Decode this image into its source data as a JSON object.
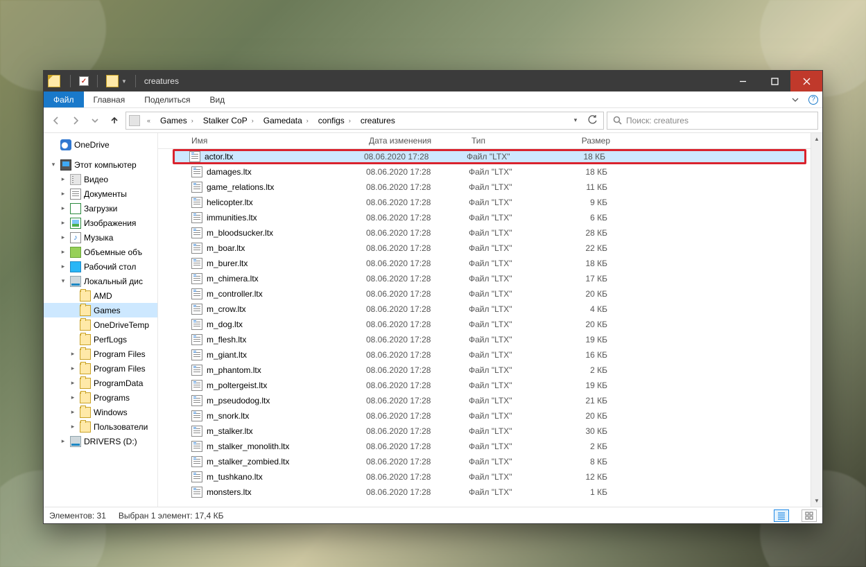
{
  "window": {
    "title": "creatures"
  },
  "ribbon": {
    "file": "Файл",
    "tabs": [
      "Главная",
      "Поделиться",
      "Вид"
    ]
  },
  "breadcrumbs": [
    "Games",
    "Stalker CoP",
    "Gamedata",
    "configs",
    "creatures"
  ],
  "search": {
    "placeholder": "Поиск: creatures"
  },
  "sidebar": [
    {
      "label": "OneDrive",
      "icon": "cloud",
      "level": 1,
      "tw": ""
    },
    {
      "label": "Этот компьютер",
      "icon": "pc",
      "level": 1,
      "tw": "▾"
    },
    {
      "label": "Видео",
      "icon": "vid",
      "level": 2,
      "tw": "▸"
    },
    {
      "label": "Документы",
      "icon": "doc",
      "level": 2,
      "tw": "▸"
    },
    {
      "label": "Загрузки",
      "icon": "dl",
      "level": 2,
      "tw": "▸"
    },
    {
      "label": "Изображения",
      "icon": "img",
      "level": 2,
      "tw": "▸"
    },
    {
      "label": "Музыка",
      "icon": "mus",
      "level": 2,
      "tw": "▸"
    },
    {
      "label": "Объемные объ",
      "icon": "obj",
      "level": 2,
      "tw": "▸"
    },
    {
      "label": "Рабочий стол",
      "icon": "desk",
      "level": 2,
      "tw": "▸"
    },
    {
      "label": "Локальный дис",
      "icon": "disk",
      "level": 2,
      "tw": "▾"
    },
    {
      "label": "AMD",
      "icon": "fld",
      "level": 3,
      "tw": ""
    },
    {
      "label": "Games",
      "icon": "fld",
      "level": 3,
      "tw": "",
      "sel": true
    },
    {
      "label": "OneDriveTemp",
      "icon": "fld",
      "level": 3,
      "tw": ""
    },
    {
      "label": "PerfLogs",
      "icon": "fld",
      "level": 3,
      "tw": ""
    },
    {
      "label": "Program Files",
      "icon": "fld",
      "level": 3,
      "tw": "▸"
    },
    {
      "label": "Program Files",
      "icon": "fld",
      "level": 3,
      "tw": "▸"
    },
    {
      "label": "ProgramData",
      "icon": "fld",
      "level": 3,
      "tw": "▸"
    },
    {
      "label": "Programs",
      "icon": "fld",
      "level": 3,
      "tw": "▸"
    },
    {
      "label": "Windows",
      "icon": "fld",
      "level": 3,
      "tw": "▸"
    },
    {
      "label": "Пользователи",
      "icon": "fld",
      "level": 3,
      "tw": "▸"
    },
    {
      "label": "DRIVERS (D:)",
      "icon": "disk",
      "level": 2,
      "tw": "▸"
    }
  ],
  "columns": {
    "name": "Имя",
    "date": "Дата изменения",
    "type": "Тип",
    "size": "Размер"
  },
  "files": [
    {
      "name": "actor.ltx",
      "date": "08.06.2020 17:28",
      "type": "Файл \"LTX\"",
      "size": "18 КБ",
      "highlight": true
    },
    {
      "name": "damages.ltx",
      "date": "08.06.2020 17:28",
      "type": "Файл \"LTX\"",
      "size": "18 КБ"
    },
    {
      "name": "game_relations.ltx",
      "date": "08.06.2020 17:28",
      "type": "Файл \"LTX\"",
      "size": "11 КБ"
    },
    {
      "name": "helicopter.ltx",
      "date": "08.06.2020 17:28",
      "type": "Файл \"LTX\"",
      "size": "9 КБ"
    },
    {
      "name": "immunities.ltx",
      "date": "08.06.2020 17:28",
      "type": "Файл \"LTX\"",
      "size": "6 КБ"
    },
    {
      "name": "m_bloodsucker.ltx",
      "date": "08.06.2020 17:28",
      "type": "Файл \"LTX\"",
      "size": "28 КБ"
    },
    {
      "name": "m_boar.ltx",
      "date": "08.06.2020 17:28",
      "type": "Файл \"LTX\"",
      "size": "22 КБ"
    },
    {
      "name": "m_burer.ltx",
      "date": "08.06.2020 17:28",
      "type": "Файл \"LTX\"",
      "size": "18 КБ"
    },
    {
      "name": "m_chimera.ltx",
      "date": "08.06.2020 17:28",
      "type": "Файл \"LTX\"",
      "size": "17 КБ"
    },
    {
      "name": "m_controller.ltx",
      "date": "08.06.2020 17:28",
      "type": "Файл \"LTX\"",
      "size": "20 КБ"
    },
    {
      "name": "m_crow.ltx",
      "date": "08.06.2020 17:28",
      "type": "Файл \"LTX\"",
      "size": "4 КБ"
    },
    {
      "name": "m_dog.ltx",
      "date": "08.06.2020 17:28",
      "type": "Файл \"LTX\"",
      "size": "20 КБ"
    },
    {
      "name": "m_flesh.ltx",
      "date": "08.06.2020 17:28",
      "type": "Файл \"LTX\"",
      "size": "19 КБ"
    },
    {
      "name": "m_giant.ltx",
      "date": "08.06.2020 17:28",
      "type": "Файл \"LTX\"",
      "size": "16 КБ"
    },
    {
      "name": "m_phantom.ltx",
      "date": "08.06.2020 17:28",
      "type": "Файл \"LTX\"",
      "size": "2 КБ"
    },
    {
      "name": "m_poltergeist.ltx",
      "date": "08.06.2020 17:28",
      "type": "Файл \"LTX\"",
      "size": "19 КБ"
    },
    {
      "name": "m_pseudodog.ltx",
      "date": "08.06.2020 17:28",
      "type": "Файл \"LTX\"",
      "size": "21 КБ"
    },
    {
      "name": "m_snork.ltx",
      "date": "08.06.2020 17:28",
      "type": "Файл \"LTX\"",
      "size": "20 КБ"
    },
    {
      "name": "m_stalker.ltx",
      "date": "08.06.2020 17:28",
      "type": "Файл \"LTX\"",
      "size": "30 КБ"
    },
    {
      "name": "m_stalker_monolith.ltx",
      "date": "08.06.2020 17:28",
      "type": "Файл \"LTX\"",
      "size": "2 КБ"
    },
    {
      "name": "m_stalker_zombied.ltx",
      "date": "08.06.2020 17:28",
      "type": "Файл \"LTX\"",
      "size": "8 КБ"
    },
    {
      "name": "m_tushkano.ltx",
      "date": "08.06.2020 17:28",
      "type": "Файл \"LTX\"",
      "size": "12 КБ"
    },
    {
      "name": "monsters.ltx",
      "date": "08.06.2020 17:28",
      "type": "Файл \"LTX\"",
      "size": "1 КБ"
    }
  ],
  "status": {
    "count": "Элементов: 31",
    "selection": "Выбран 1 элемент: 17,4 КБ"
  }
}
